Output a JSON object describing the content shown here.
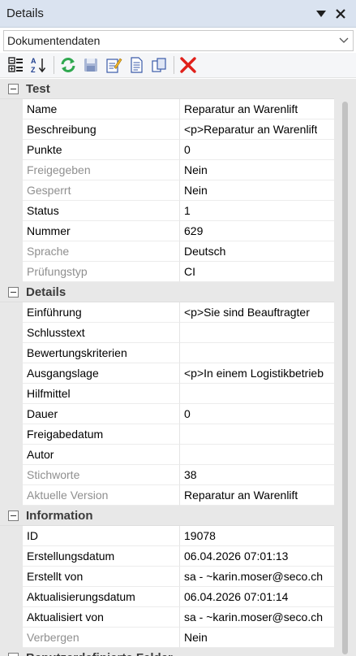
{
  "panel": {
    "title": "Details"
  },
  "dropdown": {
    "value": "Dokumentendaten"
  },
  "toolbar": {
    "buttons": [
      "categorized-icon",
      "sort-alpha-icon",
      "refresh-icon",
      "save-icon",
      "edit-icon",
      "document-icon",
      "copy-icon",
      "delete-icon"
    ]
  },
  "categories": [
    {
      "label": "Test",
      "rows": [
        {
          "name": "Name",
          "value": "Reparatur an Warenlift",
          "disabled": false
        },
        {
          "name": "Beschreibung",
          "value": "<p>Reparatur an Warenlift",
          "disabled": false
        },
        {
          "name": "Punkte",
          "value": "0",
          "disabled": false
        },
        {
          "name": "Freigegeben",
          "value": "Nein",
          "disabled": true
        },
        {
          "name": "Gesperrt",
          "value": "Nein",
          "disabled": true
        },
        {
          "name": "Status",
          "value": "1",
          "disabled": false
        },
        {
          "name": "Nummer",
          "value": "629",
          "disabled": false
        },
        {
          "name": "Sprache",
          "value": "Deutsch",
          "disabled": true
        },
        {
          "name": "Prüfungstyp",
          "value": "CI",
          "disabled": true
        }
      ]
    },
    {
      "label": "Details",
      "rows": [
        {
          "name": "Einführung",
          "value": "<p>Sie sind Beauftragter",
          "disabled": false
        },
        {
          "name": "Schlusstext",
          "value": "",
          "disabled": false
        },
        {
          "name": "Bewertungskriterien",
          "value": "",
          "disabled": false
        },
        {
          "name": "Ausgangslage",
          "value": "<p>In einem Logistikbetrieb",
          "disabled": false
        },
        {
          "name": "Hilfmittel",
          "value": "",
          "disabled": false
        },
        {
          "name": "Dauer",
          "value": "0",
          "disabled": false
        },
        {
          "name": "Freigabedatum",
          "value": "",
          "disabled": false
        },
        {
          "name": "Autor",
          "value": "",
          "disabled": false
        },
        {
          "name": "Stichworte",
          "value": "38",
          "disabled": true
        },
        {
          "name": "Aktuelle Version",
          "value": "Reparatur an Warenlift",
          "disabled": true
        }
      ]
    },
    {
      "label": "Information",
      "rows": [
        {
          "name": "ID",
          "value": "19078",
          "disabled": false
        },
        {
          "name": "Erstellungsdatum",
          "value": "06.04.2026 07:01:13",
          "disabled": false
        },
        {
          "name": "Erstellt von",
          "value": "sa - ~karin.moser@seco.ch",
          "disabled": false
        },
        {
          "name": "Aktualisierungsdatum",
          "value": "06.04.2026 07:01:14",
          "disabled": false
        },
        {
          "name": "Aktualisiert von",
          "value": "sa - ~karin.moser@seco.ch",
          "disabled": false
        },
        {
          "name": "Verbergen",
          "value": "Nein",
          "disabled": true
        }
      ]
    },
    {
      "label": "Benutzerdefinierte Felder",
      "rows": []
    }
  ],
  "colors": {
    "titlebar": "#dae3f0",
    "category": "#e8e8e8",
    "disabled_text": "#8f8f8f"
  }
}
